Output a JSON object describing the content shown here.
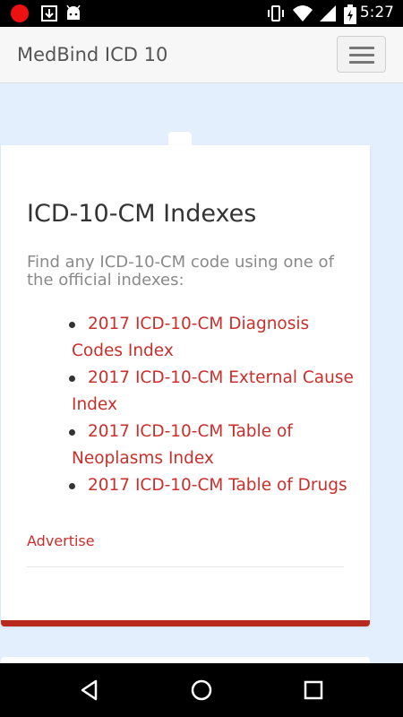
{
  "status_bar": {
    "time": "5:27",
    "icons": [
      "record-icon",
      "download-icon",
      "android-icon",
      "vibrate-icon",
      "wifi-icon",
      "signal-icon",
      "battery-icon"
    ]
  },
  "app_bar": {
    "brand": "MedBind ICD 10",
    "menu_icon": "hamburger-menu-icon"
  },
  "card": {
    "title": "ICD-10-CM Indexes",
    "lead": "Find any ICD-10-CM code using one of the official indexes:",
    "links": [
      {
        "label": "2017 ICD-10-CM Diagnosis Codes Index"
      },
      {
        "label": "2017 ICD-10-CM External Cause Index"
      },
      {
        "label": "2017 ICD-10-CM Table of Neoplasms Index"
      },
      {
        "label": "2017 ICD-10-CM Table of Drugs"
      }
    ],
    "advertise": "Advertise",
    "accent_color": "#c9302c"
  },
  "nav_bar": {
    "icons": [
      "back-icon",
      "home-icon",
      "recents-icon"
    ]
  }
}
